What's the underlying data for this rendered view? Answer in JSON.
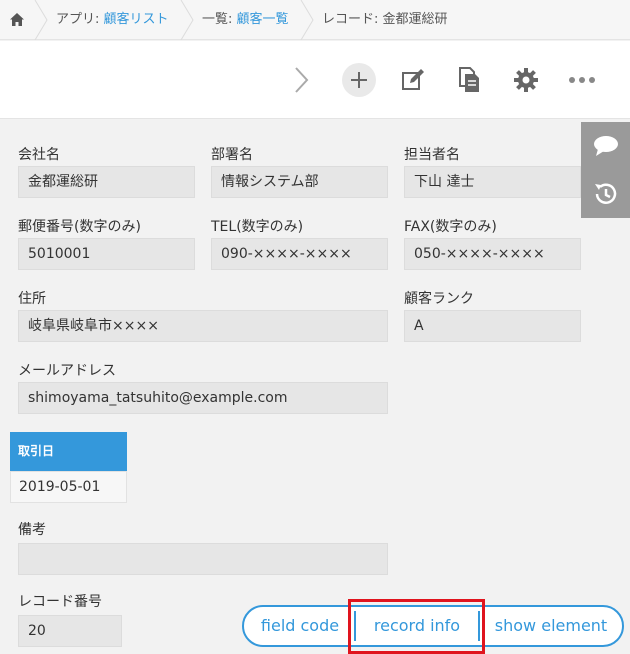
{
  "breadcrumb": {
    "app_prefix": "アプリ: ",
    "app_name": "顧客リスト",
    "list_prefix": "一覧: ",
    "list_name": "顧客一覧",
    "record": "レコード: 金都運総研"
  },
  "fields": {
    "company": {
      "label": "会社名",
      "value": "金都運総研"
    },
    "department": {
      "label": "部署名",
      "value": "情報システム部"
    },
    "contact": {
      "label": "担当者名",
      "value": "下山 達士"
    },
    "postal": {
      "label": "郵便番号(数字のみ)",
      "value": "5010001"
    },
    "tel": {
      "label": "TEL(数字のみ)",
      "value": "090-××××-××××"
    },
    "fax": {
      "label": "FAX(数字のみ)",
      "value": "050-××××-××××"
    },
    "address": {
      "label": "住所",
      "value": "岐阜県岐阜市××××"
    },
    "rank": {
      "label": "顧客ランク",
      "value": "A"
    },
    "email": {
      "label": "メールアドレス",
      "value": "shimoyama_tatsuhito@example.com"
    },
    "trade_date": {
      "label": "取引日",
      "value": "2019-05-01"
    },
    "notes": {
      "label": "備考",
      "value": ""
    },
    "record_number": {
      "label": "レコード番号",
      "value": "20"
    }
  },
  "helper_buttons": {
    "field_code": "field code",
    "record_info": "record info",
    "show_element": "show element"
  },
  "icons": {
    "home": "home-icon",
    "next": "chevron-right-icon",
    "add": "plus-icon",
    "edit": "edit-icon",
    "copy": "copy-icon",
    "settings": "gear-icon",
    "more": "more-icon",
    "comment": "comment-icon",
    "history": "history-icon"
  },
  "colors": {
    "accent": "#3498db",
    "highlight": "#e0141e"
  }
}
